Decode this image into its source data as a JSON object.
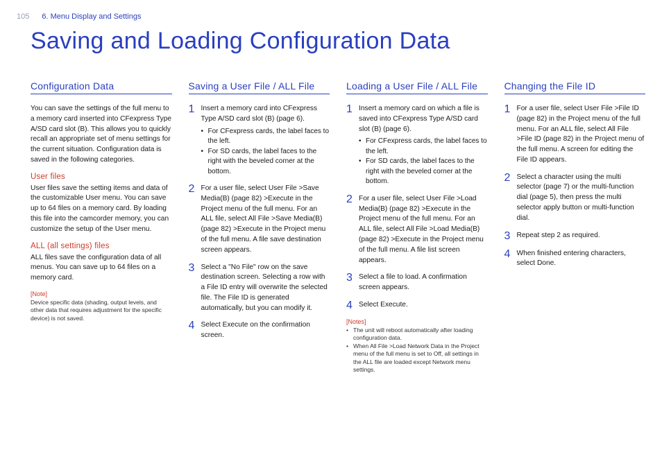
{
  "header": {
    "page_number": "105",
    "breadcrumb": "6. Menu Display and Settings"
  },
  "title": "Saving and Loading Configuration Data",
  "columns": {
    "config": {
      "heading": "Configuration Data",
      "intro": "You can save the settings of the full menu to a memory card inserted into CFexpress Type A/SD card slot (B). This allows you to quickly recall an appropriate set of menu settings for the current situation.\nConfiguration data is saved in the following categories.",
      "user_files_head": "User files",
      "user_files_body": "User files save the setting items and data of the customizable User menu.\nYou can save up to 64 files on a memory card.\nBy loading this file into the camcorder memory, you can customize the setup of the User menu.",
      "all_files_head": "ALL (all settings) files",
      "all_files_body": "ALL files save the configuration data of all menus. You can save up to 64 files on a memory card.",
      "note_head": "[Note]",
      "note_body": "Device specific data (shading, output levels, and other data that requires adjustment for the specific device) is not saved."
    },
    "saving": {
      "heading": "Saving a User File / ALL File",
      "steps": [
        {
          "n": "1",
          "text": "Insert a memory card into CFexpress Type A/SD card slot (B) (page 6).",
          "bullets": [
            "For CFexpress cards, the label faces to the left.",
            "For SD cards, the label faces to the right with the beveled corner at the bottom."
          ]
        },
        {
          "n": "2",
          "text": "For a user file, select User File >Save Media(B) (page 82) >Execute in the Project menu of the full menu.\nFor an ALL file, select All File >Save Media(B) (page 82) >Execute in the Project menu of the full menu.\nA file save destination screen appears."
        },
        {
          "n": "3",
          "text": "Select a \"No File\" row on the save destination screen.\nSelecting a row with a File ID entry will overwrite the selected file.\nThe File ID is generated automatically, but you can modify it."
        },
        {
          "n": "4",
          "text": "Select Execute on the confirmation screen."
        }
      ]
    },
    "loading": {
      "heading": "Loading a User File / ALL File",
      "steps": [
        {
          "n": "1",
          "text": "Insert a memory card on which a file is saved into CFexpress Type A/SD card slot (B) (page 6).",
          "bullets": [
            "For CFexpress cards, the label faces to the left.",
            "For SD cards, the label faces to the right with the beveled corner at the bottom."
          ]
        },
        {
          "n": "2",
          "text": "For a user file, select User File >Load Media(B) (page 82) >Execute in the Project menu of the full menu.\nFor an ALL file, select All File >Load Media(B) (page 82) >Execute in the Project menu of the full menu.\nA file list screen appears."
        },
        {
          "n": "3",
          "text": "Select a file to load.\nA confirmation screen appears."
        },
        {
          "n": "4",
          "text": "Select Execute."
        }
      ],
      "notes_head": "[Notes]",
      "notes": [
        "The unit will reboot automatically after loading configuration data.",
        "When All File >Load Network Data in the Project menu of the full menu is set to Off, all settings in the ALL file are loaded except Network menu settings."
      ]
    },
    "fileid": {
      "heading": "Changing the File ID",
      "steps": [
        {
          "n": "1",
          "text": "For a user file, select User File >File ID (page 82) in the Project menu of the full menu.\nFor an ALL file, select All File >File ID (page 82) in the Project menu of the full menu.\nA screen for editing the File ID appears."
        },
        {
          "n": "2",
          "text": "Select a character using the multi selector (page 7) or the multi-function dial (page 5), then press the multi selector apply button or multi-function dial."
        },
        {
          "n": "3",
          "text": "Repeat step 2 as required."
        },
        {
          "n": "4",
          "text": "When finished entering characters, select Done."
        }
      ]
    }
  }
}
